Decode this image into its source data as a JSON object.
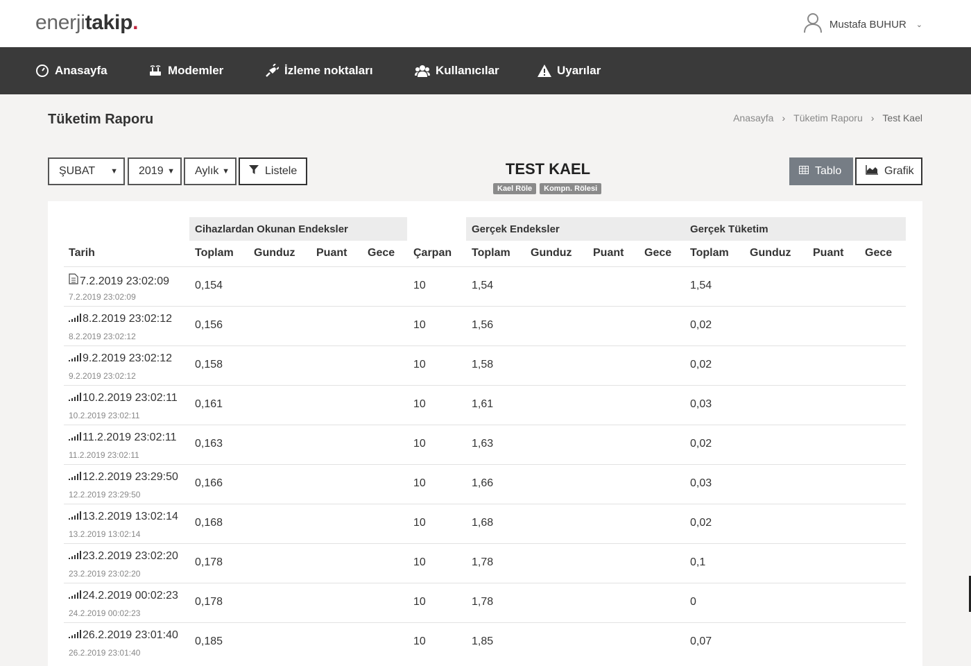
{
  "header": {
    "logo_light": "enerji",
    "logo_bold": "takip",
    "logo_dot": ".",
    "user_name": "Mustafa BUHUR"
  },
  "nav": [
    {
      "label": "Anasayfa",
      "icon": "dashboard-icon"
    },
    {
      "label": "Modemler",
      "icon": "modem-icon"
    },
    {
      "label": "İzleme noktaları",
      "icon": "plug-icon"
    },
    {
      "label": "Kullanıcılar",
      "icon": "users-icon"
    },
    {
      "label": "Uyarılar",
      "icon": "warning-icon"
    }
  ],
  "page": {
    "title": "Tüketim Raporu",
    "breadcrumb": [
      "Anasayfa",
      "Tüketim Raporu",
      "Test Kael"
    ]
  },
  "filters": {
    "month": "ŞUBAT",
    "year": "2019",
    "period": "Aylık",
    "list_button": "Listele"
  },
  "report": {
    "title": "TEST KAEL",
    "tags": [
      "Kael Röle",
      "Kompn. Rölesi"
    ]
  },
  "view_buttons": {
    "table": "Tablo",
    "chart": "Grafik"
  },
  "table": {
    "groups": {
      "device": "Cihazlardan Okunan Endeksler",
      "real_index": "Gerçek Endeksler",
      "real_consumption": "Gerçek Tüketim"
    },
    "columns": {
      "date": "Tarih",
      "toplam": "Toplam",
      "gunduz": "Gunduz",
      "puant": "Puant",
      "gece": "Gece",
      "carpan": "Çarpan"
    },
    "rows": [
      {
        "date": "7.2.2019 23:02:09",
        "sub": "7.2.2019 23:02:09",
        "icon": "document-icon",
        "dev": "0,154",
        "carpan": "10",
        "real": "1,54",
        "cons": "1,54"
      },
      {
        "date": "8.2.2019 23:02:12",
        "sub": "8.2.2019 23:02:12",
        "icon": "signal-icon",
        "dev": "0,156",
        "carpan": "10",
        "real": "1,56",
        "cons": "0,02"
      },
      {
        "date": "9.2.2019 23:02:12",
        "sub": "9.2.2019 23:02:12",
        "icon": "signal-icon",
        "dev": "0,158",
        "carpan": "10",
        "real": "1,58",
        "cons": "0,02"
      },
      {
        "date": "10.2.2019 23:02:11",
        "sub": "10.2.2019 23:02:11",
        "icon": "signal-icon",
        "dev": "0,161",
        "carpan": "10",
        "real": "1,61",
        "cons": "0,03"
      },
      {
        "date": "11.2.2019 23:02:11",
        "sub": "11.2.2019 23:02:11",
        "icon": "signal-icon",
        "dev": "0,163",
        "carpan": "10",
        "real": "1,63",
        "cons": "0,02"
      },
      {
        "date": "12.2.2019 23:29:50",
        "sub": "12.2.2019 23:29:50",
        "icon": "signal-icon",
        "dev": "0,166",
        "carpan": "10",
        "real": "1,66",
        "cons": "0,03"
      },
      {
        "date": "13.2.2019 13:02:14",
        "sub": "13.2.2019 13:02:14",
        "icon": "signal-icon",
        "dev": "0,168",
        "carpan": "10",
        "real": "1,68",
        "cons": "0,02"
      },
      {
        "date": "23.2.2019 23:02:20",
        "sub": "23.2.2019 23:02:20",
        "icon": "signal-icon",
        "dev": "0,178",
        "carpan": "10",
        "real": "1,78",
        "cons": "0,1"
      },
      {
        "date": "24.2.2019 00:02:23",
        "sub": "24.2.2019 00:02:23",
        "icon": "signal-icon",
        "dev": "0,178",
        "carpan": "10",
        "real": "1,78",
        "cons": "0"
      },
      {
        "date": "26.2.2019 23:01:40",
        "sub": "26.2.2019 23:01:40",
        "icon": "signal-icon",
        "dev": "0,185",
        "carpan": "10",
        "real": "1,85",
        "cons": "0,07"
      }
    ]
  }
}
